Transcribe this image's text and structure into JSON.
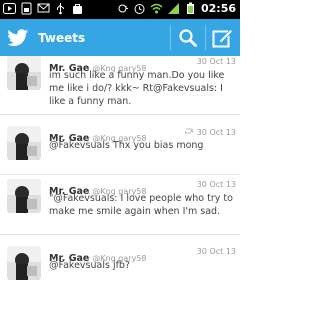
{
  "status_bar": {
    "time": "02:56",
    "icons_left": [
      "play-icon",
      "sim-icon",
      "notification-icon",
      "usb-icon",
      "bag-icon"
    ],
    "icons_right": [
      "sync-icon",
      "alarm-icon",
      "wifi-icon",
      "signal-icon",
      "battery-icon"
    ]
  },
  "action_bar": {
    "title": "Tweets",
    "logo_icon": "twitter-bird-icon",
    "search_icon": "search-icon",
    "compose_icon": "compose-icon",
    "background": "#35a5e4"
  },
  "tweets": [
    {
      "name": "Mr. Gae",
      "handle": "@Kng gary58",
      "date": "30 Oct 13",
      "text": "im such like a funny man.Do you like me like i do/? kkk~ Rt@Fakevsuals: I like a funny man.",
      "retweet_icon": false
    },
    {
      "name": "Mr. Gae",
      "handle": "@Kng gary58",
      "date": "30 Oct 13",
      "text": "@Fakevsuals Thx you bias mong",
      "retweet_icon": true
    },
    {
      "name": "Mr. Gae",
      "handle": "@Kng gary58",
      "date": "30 Oct 13",
      "text": "\"@Fakevsuals: I love people who try to make me smile again when I'm sad.",
      "retweet_icon": false
    },
    {
      "name": "Mr. Gae",
      "handle": "@Kng gary58",
      "date": "30 Oct 13",
      "text": "@Fakevsuals jfb?",
      "retweet_icon": false
    }
  ]
}
